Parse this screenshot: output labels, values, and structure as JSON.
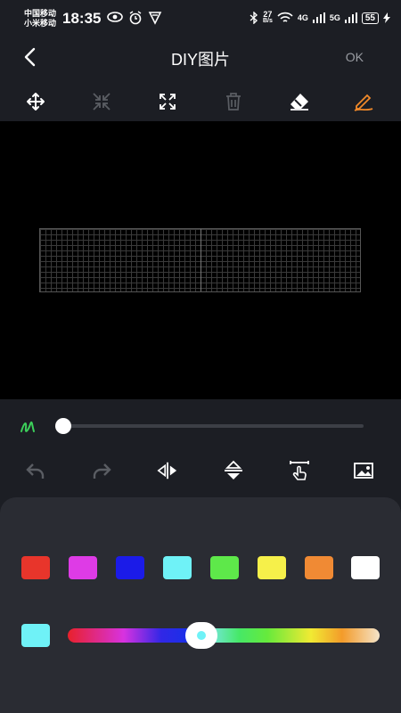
{
  "status_bar": {
    "carrier_1": "中国移动",
    "carrier_2": "小米移动",
    "time": "18:35",
    "network_speed": "27",
    "network_unit": "B/s",
    "signal_1_label": "4G",
    "signal_2_label": "5G",
    "battery": "55"
  },
  "header": {
    "title": "DIY图片",
    "ok_label": "OK"
  },
  "toolbar": {
    "tools": [
      "move-icon",
      "shrink-icon",
      "expand-icon",
      "delete-icon",
      "eraser-icon",
      "pen-icon"
    ],
    "active_tool": "pen-icon",
    "active_color": "#f0892a"
  },
  "brush": {
    "size_fraction": 0.0
  },
  "palette": {
    "swatches": [
      "#e8352b",
      "#de3be6",
      "#1b1be8",
      "#6ff2f7",
      "#5ee84a",
      "#f6f04a",
      "#f08a34",
      "#ffffff"
    ],
    "current_color": "#6ff2f7",
    "hue_position_fraction": 0.43
  }
}
